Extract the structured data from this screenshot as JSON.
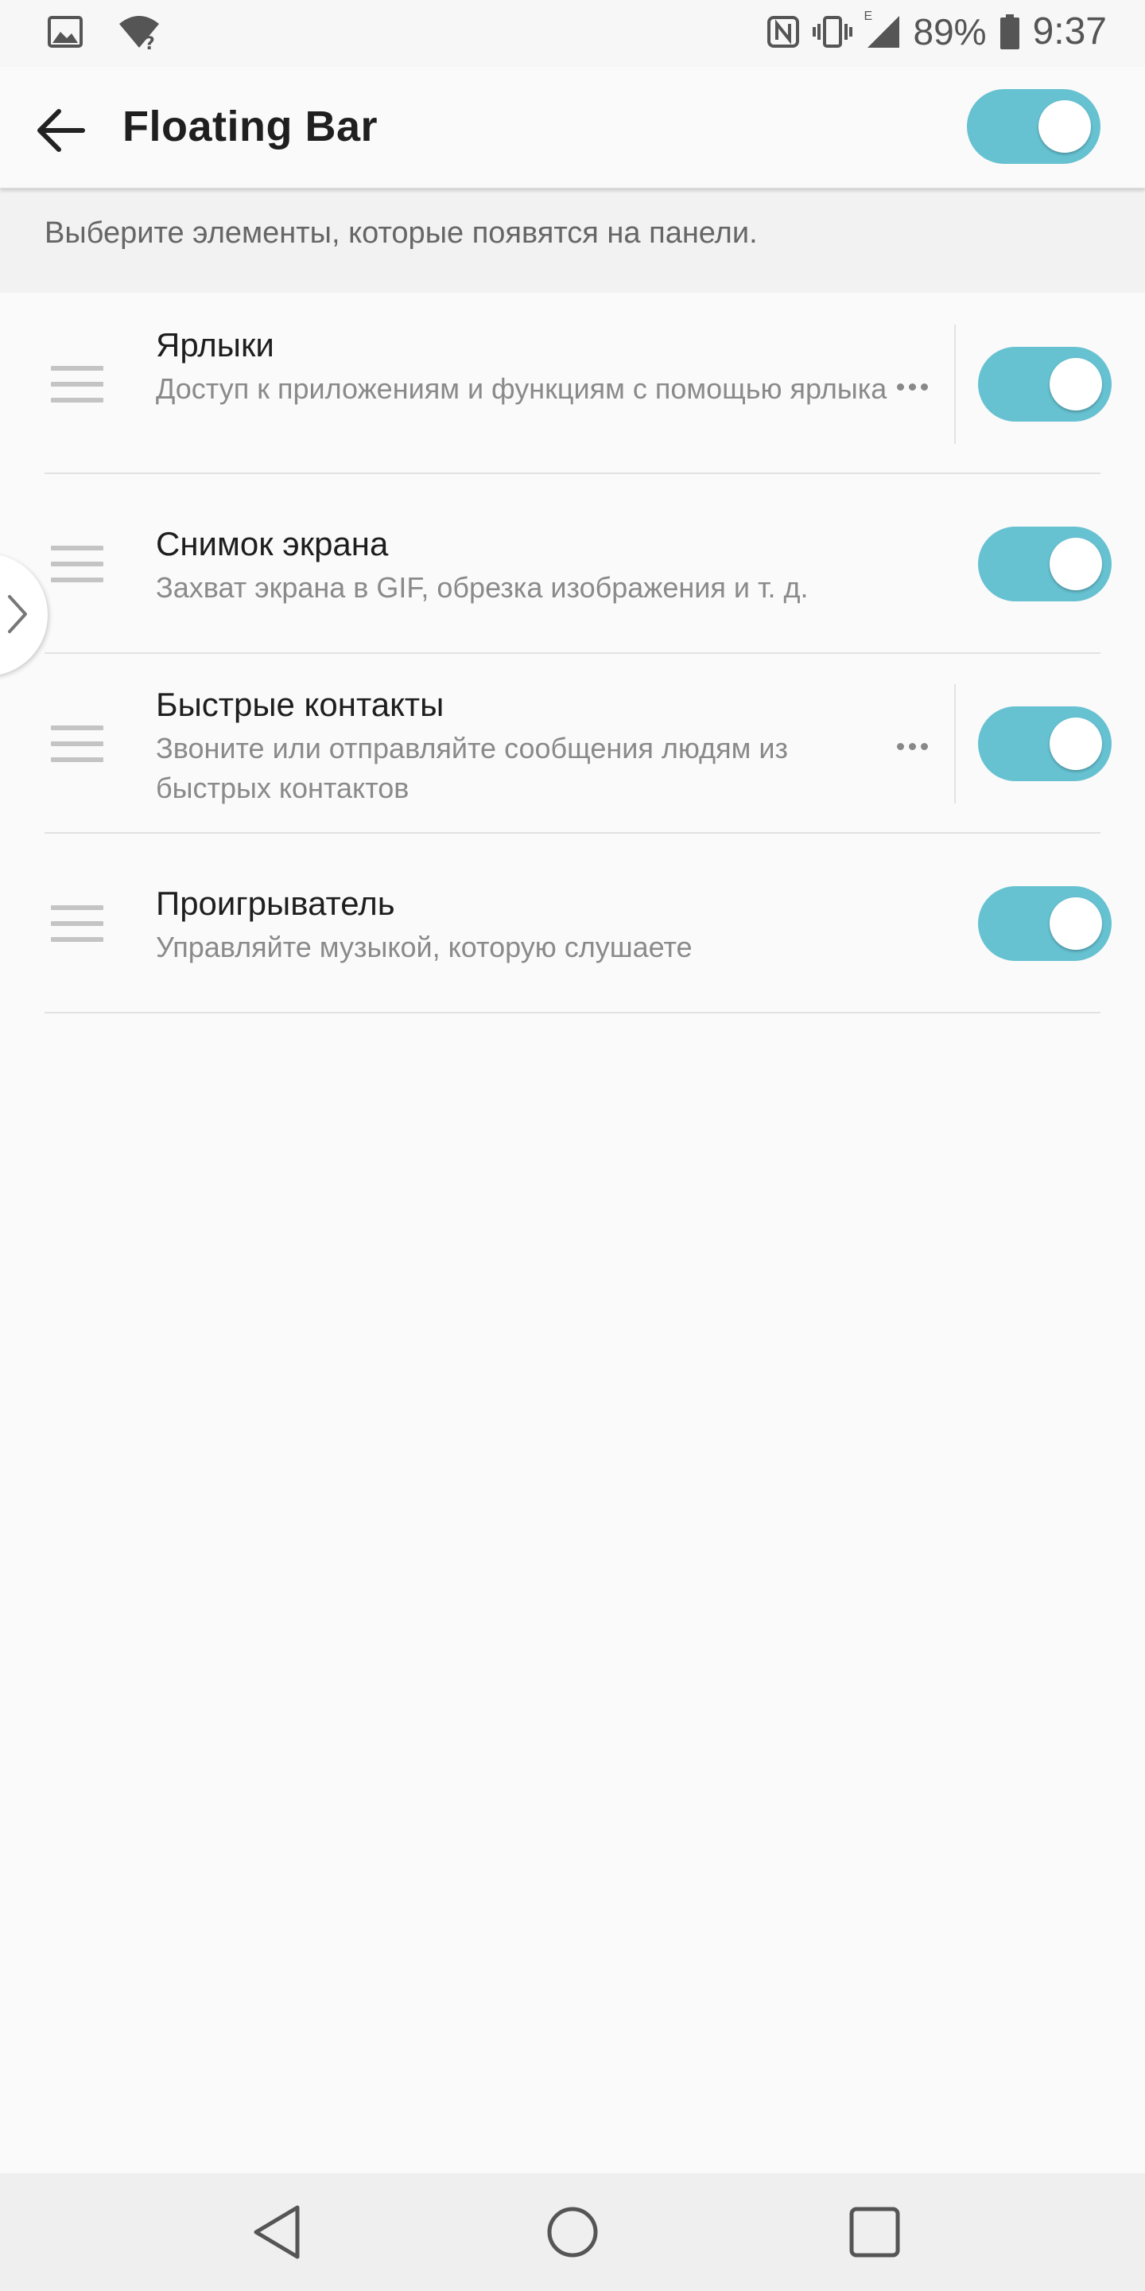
{
  "status_bar": {
    "battery_percent": "89%",
    "time": "9:37",
    "network_type": "E",
    "left_icons": [
      "gallery-notification-icon",
      "wifi-unknown-icon"
    ],
    "right_icons": [
      "nfc-icon",
      "vibrate-icon",
      "cell-signal-icon",
      "battery-icon"
    ]
  },
  "app_bar": {
    "title": "Floating Bar",
    "master_toggle_on": true
  },
  "description": "Выберите элементы, которые появятся на панели.",
  "items": [
    {
      "title": "Ярлыки",
      "subtitle": "Доступ к приложениям и функциям с помощью ярлыка",
      "has_more": true,
      "enabled": true
    },
    {
      "title": "Снимок экрана",
      "subtitle": "Захват экрана в GIF, обрезка изображения и т. д.",
      "has_more": false,
      "enabled": true
    },
    {
      "title": "Быстрые контакты",
      "subtitle": "Звоните или отправляйте сообщения людям из быстрых контактов",
      "has_more": true,
      "enabled": true
    },
    {
      "title": "Проигрыватель",
      "subtitle": "Управляйте музыкой, которую слушаете",
      "has_more": false,
      "enabled": true
    }
  ],
  "colors": {
    "toggle_on": "#66c1d1",
    "background": "#fafafa",
    "divider": "#e2e2e2"
  },
  "nav_bar": {
    "buttons": [
      "back-triangle-icon",
      "home-circle-icon",
      "recents-square-icon"
    ]
  }
}
